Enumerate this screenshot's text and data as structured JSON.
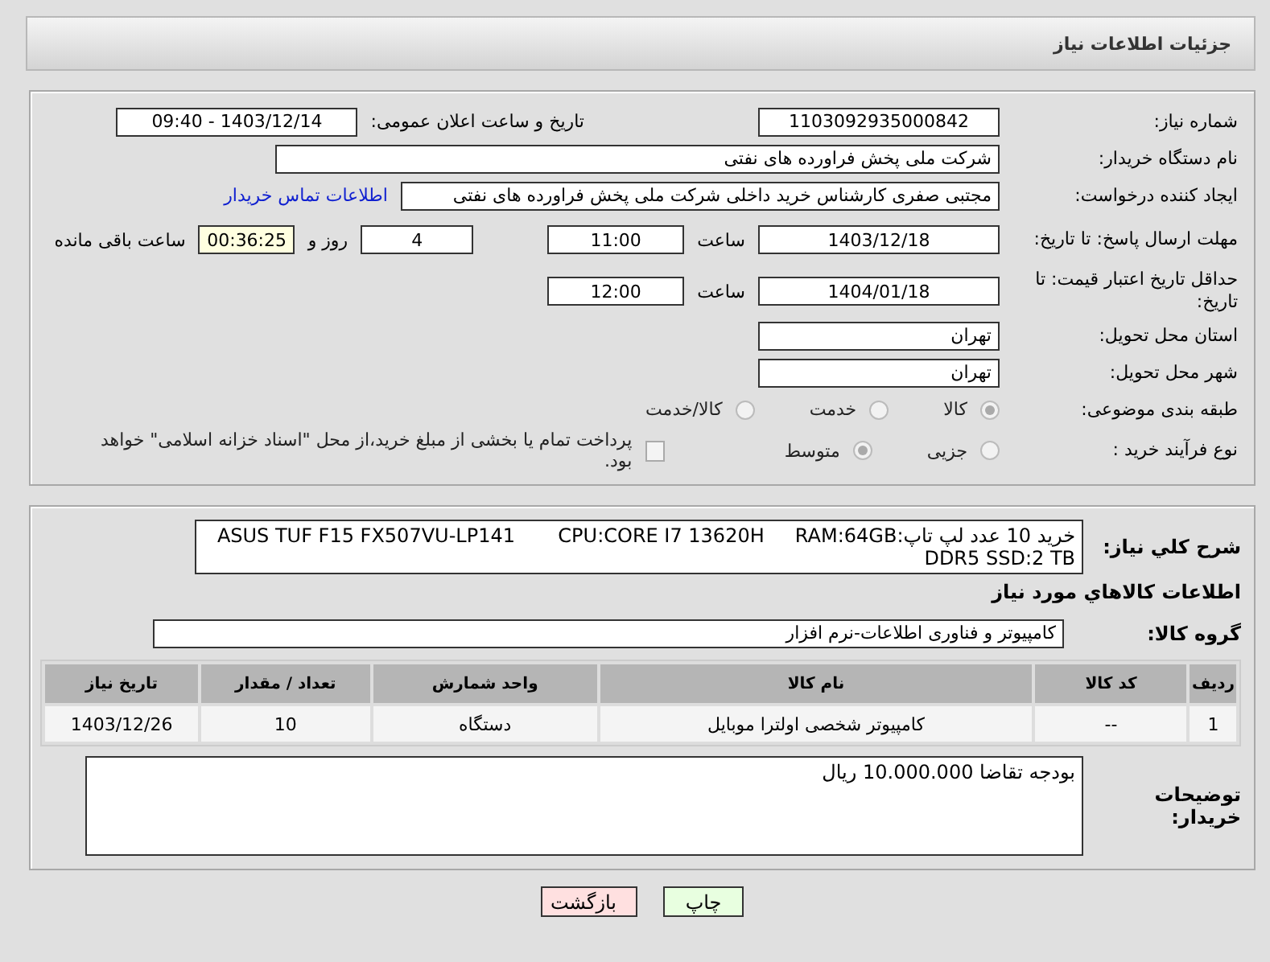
{
  "header": {
    "title": "جزئیات اطلاعات نیاز"
  },
  "need_number": {
    "label": "شماره نیاز:",
    "value": "1103092935000842"
  },
  "announce": {
    "label": "تاریخ و ساعت اعلان عمومی:",
    "value": "09:40 - 1403/12/14"
  },
  "buyer_org": {
    "label": "نام دستگاه خریدار:",
    "value": "شرکت ملی پخش فراورده های نفتی"
  },
  "requester": {
    "label": "ایجاد کننده درخواست:",
    "value": "مجتبی صفری کارشناس خرید داخلی شرکت ملی پخش فراورده های نفتی",
    "link": "اطلاعات تماس خریدار"
  },
  "reply_deadline": {
    "label": "مهلت ارسال پاسخ: تا تاریخ:",
    "date": "1403/12/18",
    "time_label": "ساعت",
    "time": "11:00",
    "days": "4",
    "days_label": "روز و",
    "remaining": "00:36:25",
    "remaining_label": "ساعت باقی مانده"
  },
  "price_validity": {
    "label": "حداقل تاریخ اعتبار قیمت: تا تاریخ:",
    "date": "1404/01/18",
    "time_label": "ساعت",
    "time": "12:00"
  },
  "province": {
    "label": "استان محل تحویل:",
    "value": "تهران"
  },
  "city": {
    "label": "شهر محل تحویل:",
    "value": "تهران"
  },
  "category": {
    "label": "طبقه بندی موضوعی:",
    "options": [
      {
        "label": "کالا",
        "selected": true
      },
      {
        "label": "خدمت",
        "selected": false
      },
      {
        "label": "کالا/خدمت",
        "selected": false
      }
    ]
  },
  "process": {
    "label": "نوع فرآیند خرید :",
    "options": [
      {
        "label": "جزیی",
        "selected": false
      },
      {
        "label": "متوسط",
        "selected": true
      }
    ],
    "treasury": {
      "label": "پرداخت تمام یا بخشی از مبلغ خرید،از محل \"اسناد خزانه اسلامی\" خواهد بود.",
      "checked": false
    }
  },
  "description": {
    "label": "شرح کلي نیاز:",
    "value": "خرید 10 عدد لپ تاپ:ASUS TUF F15 FX507VU-LP141       CPU:CORE I7 13620H     RAM:64GB DDR5 SSD:2 TB"
  },
  "goods_heading": "اطلاعات کالاهاي مورد نياز",
  "goods_group": {
    "label": "گروه کالا:",
    "value": "کامپیوتر و فناوری اطلاعات-نرم افزار"
  },
  "table": {
    "columns": [
      "ردیف",
      "کد کالا",
      "نام کالا",
      "واحد شمارش",
      "تعداد / مقدار",
      "تاریخ نیاز"
    ],
    "rows": [
      [
        "1",
        "--",
        "کامپیوتر شخصی اولترا موبایل",
        "دستگاه",
        "10",
        "1403/12/26"
      ]
    ]
  },
  "buyer_notes": {
    "label": "توضیحات خریدار:",
    "value": "بودجه تقاضا 10.000.000 ریال"
  },
  "buttons": [
    {
      "label": "چاپ",
      "kind": "print"
    },
    {
      "label": "بازگشت",
      "kind": "back"
    }
  ]
}
